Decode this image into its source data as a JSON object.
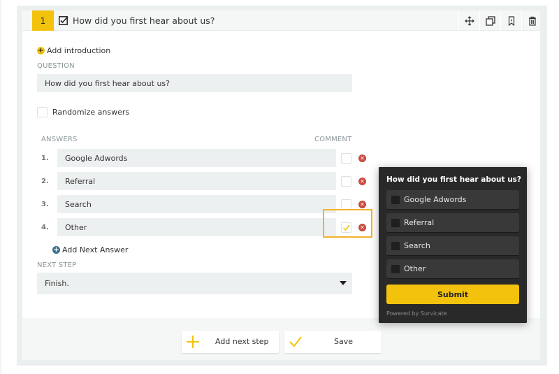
{
  "question_card": {
    "number": "1",
    "title": "How did you first hear about us?",
    "header_actions": [
      {
        "name": "move-icon",
        "label": "Move"
      },
      {
        "name": "duplicate-icon",
        "label": "Duplicate"
      },
      {
        "name": "bookmark-icon",
        "label": "Bookmark"
      },
      {
        "name": "trash-icon",
        "label": "Delete"
      }
    ],
    "add_introduction": "Add introduction",
    "question_label": "QUESTION",
    "question_value": "How did you first hear about us?",
    "randomize_label": "Randomize answers",
    "randomize_checked": false,
    "answers_label": "ANSWERS",
    "comment_label": "COMMENT",
    "answers": [
      {
        "num": "1.",
        "text": "Google Adwords",
        "comment": false
      },
      {
        "num": "2.",
        "text": "Referral",
        "comment": false
      },
      {
        "num": "3.",
        "text": "Search",
        "comment": false
      },
      {
        "num": "4.",
        "text": "Other",
        "comment": true
      }
    ],
    "add_next_answer": "Add Next Answer",
    "next_step_label": "NEXT STEP",
    "next_step_value": "Finish."
  },
  "footer": {
    "add_next_step": "Add next step",
    "save": "Save"
  },
  "preview_widget": {
    "title": "How did you first hear about us?",
    "options": [
      "Google Adwords",
      "Referral",
      "Search",
      "Other"
    ],
    "submit": "Submit",
    "powered_by": "Powered by Survicate"
  },
  "colors": {
    "accent": "#f2c20d",
    "highlight": "#f4b12a",
    "delete": "#c94b3f",
    "add_answer": "#3c6f8f",
    "widget_bg": "#292929"
  }
}
